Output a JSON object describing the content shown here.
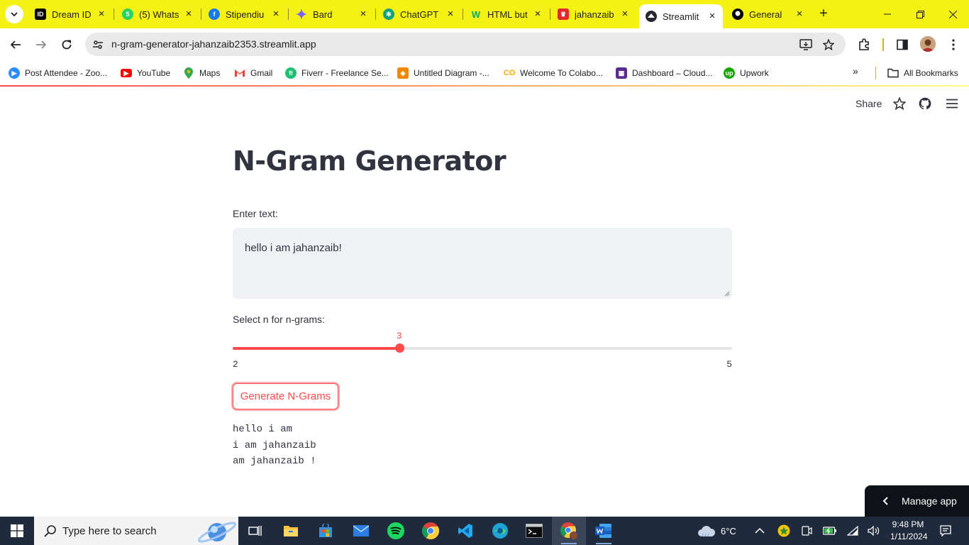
{
  "browser": {
    "tabs": [
      {
        "title": "Dream ID",
        "favicon": "dream-id-icon",
        "color": "#000000"
      },
      {
        "title": "(5) Whats",
        "favicon": "whatsapp-icon",
        "color": "#25d366"
      },
      {
        "title": "Stipendiu",
        "favicon": "facebook-icon",
        "color": "#1877f2"
      },
      {
        "title": "Bard",
        "favicon": "bard-icon",
        "color": "#7b61ff"
      },
      {
        "title": "ChatGPT",
        "favicon": "chatgpt-icon",
        "color": "#10a37f"
      },
      {
        "title": "HTML but",
        "favicon": "w3-icon",
        "color": "#04aa6d"
      },
      {
        "title": "jahanzaib",
        "favicon": "crown-icon",
        "color": "#e0282e"
      },
      {
        "title": "Streamlit",
        "favicon": "streamlit-icon",
        "color": "#262730"
      },
      {
        "title": "General",
        "favicon": "github-icon",
        "color": "#000000"
      }
    ],
    "active_tab_index": 7,
    "url": "n-gram-generator-jahanzaib2353.streamlit.app",
    "accent": "#f5f115"
  },
  "bookmarks": {
    "items": [
      {
        "label": "Post Attendee - Zoo...",
        "icon": "zoom-icon",
        "color": "#2d8cff"
      },
      {
        "label": "YouTube",
        "icon": "youtube-icon",
        "color": "#ff0000"
      },
      {
        "label": "Maps",
        "icon": "maps-icon",
        "color": "#34a853"
      },
      {
        "label": "Gmail",
        "icon": "gmail-icon",
        "color": "#ea4335"
      },
      {
        "label": "Fiverr - Freelance Se...",
        "icon": "fiverr-icon",
        "color": "#1dbf73"
      },
      {
        "label": "Untitled Diagram -...",
        "icon": "drawio-icon",
        "color": "#f08705"
      },
      {
        "label": "Welcome To Colabo...",
        "icon": "colab-icon",
        "color": "#f9ab00"
      },
      {
        "label": "Dashboard – Cloud...",
        "icon": "cloud-dashboard-icon",
        "color": "#5b2c8f"
      },
      {
        "label": "Upwork",
        "icon": "upwork-icon",
        "color": "#14a800"
      }
    ],
    "all_bookmarks": "All Bookmarks"
  },
  "app": {
    "header": {
      "share": "Share"
    },
    "title": "N-Gram Generator",
    "text_label": "Enter text:",
    "text_value": "hello i am jahanzaib!",
    "slider_label": "Select n for n-grams:",
    "slider": {
      "min": 2,
      "max": 5,
      "value": 3,
      "value_text": "3",
      "min_text": "2",
      "max_text": "5"
    },
    "button_label": "Generate N-Grams",
    "output_lines": [
      "hello i am",
      "i am jahanzaib",
      "am jahanzaib !"
    ],
    "manage_app": "Manage app",
    "accent": "#ff4b4b"
  },
  "taskbar": {
    "search_placeholder": "Type here to search",
    "weather": "6°C",
    "time": "9:48 PM",
    "date": "1/11/2024",
    "apps": [
      "task-view-icon",
      "file-explorer-icon",
      "microsoft-store-icon",
      "mail-icon",
      "spotify-icon",
      "chrome-icon",
      "vscode-icon",
      "edge-icon",
      "terminal-icon",
      "chrome-profile-icon",
      "word-icon"
    ]
  }
}
